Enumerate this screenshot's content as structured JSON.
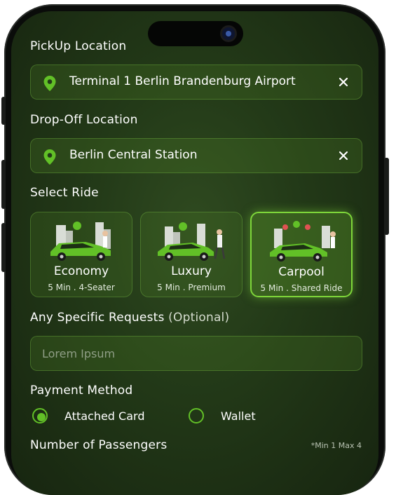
{
  "pickup": {
    "label": "PickUp Location",
    "value": "Terminal 1 Berlin Brandenburg Airport",
    "icon": "location-pin-icon",
    "clear_icon": "close-icon"
  },
  "dropoff": {
    "label": "Drop-Off Location",
    "value": "Berlin Central Station",
    "icon": "location-pin-icon",
    "clear_icon": "close-icon"
  },
  "select_ride": {
    "label": "Select Ride",
    "options": [
      {
        "name": "Economy",
        "time": "5 Min",
        "detail": "4-Seater",
        "selected": false
      },
      {
        "name": "Luxury",
        "time": "5 Min",
        "detail": "Premium",
        "selected": false
      },
      {
        "name": "Carpool",
        "time": "5 Min",
        "detail": "Shared Ride",
        "selected": true
      }
    ],
    "separator": "."
  },
  "requests": {
    "label": "Any Specific Requests",
    "optional": "(Optional)",
    "placeholder": "Lorem Ipsum"
  },
  "payment": {
    "label": "Payment Method",
    "options": [
      {
        "label": "Attached Card",
        "selected": true
      },
      {
        "label": "Wallet",
        "selected": false
      }
    ]
  },
  "passengers": {
    "label": "Number of Passengers",
    "note": "*Min 1 Max 4"
  },
  "colors": {
    "accent": "#62C027",
    "background": "#233A18",
    "field": "#2E4A1E"
  }
}
